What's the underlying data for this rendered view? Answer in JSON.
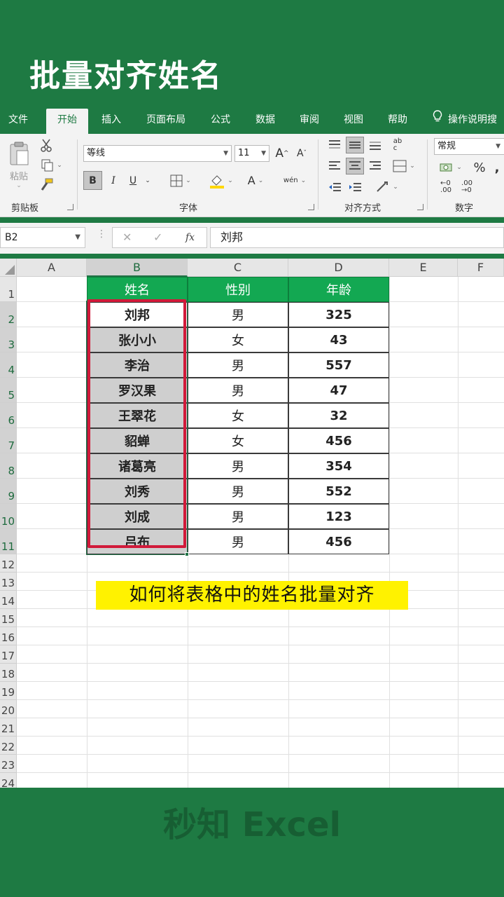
{
  "page_title": "批量对齐姓名",
  "ribbon": {
    "tabs": [
      "文件",
      "开始",
      "插入",
      "页面布局",
      "公式",
      "数据",
      "审阅",
      "视图",
      "帮助"
    ],
    "active_tab": "开始",
    "tell_me": "操作说明搜",
    "clipboard": {
      "paste": "粘贴",
      "label": "剪贴板"
    },
    "font": {
      "name": "等线",
      "size": "11",
      "bold": "B",
      "italic": "I",
      "underline": "U",
      "font_color_letter": "A",
      "phonetic": "wén",
      "label": "字体"
    },
    "alignment": {
      "label": "对齐方式"
    },
    "number": {
      "format": "常规",
      "percent": "%",
      "comma": ",",
      "label": "数字"
    }
  },
  "formula_bar": {
    "name_box": "B2",
    "cancel": "✕",
    "enter": "✓",
    "fx": "fx",
    "value": "刘邦"
  },
  "sheet": {
    "columns": [
      "A",
      "B",
      "C",
      "D",
      "E",
      "F"
    ],
    "rows": [
      "1",
      "2",
      "3",
      "4",
      "5",
      "6",
      "7",
      "8",
      "9",
      "10",
      "11",
      "12",
      "13",
      "14",
      "15",
      "16",
      "17",
      "18",
      "19",
      "20",
      "21",
      "22",
      "23",
      "24"
    ],
    "headers": [
      "姓名",
      "性别",
      "年龄"
    ],
    "data": [
      [
        "刘邦",
        "男",
        "325"
      ],
      [
        "张小小",
        "女",
        "43"
      ],
      [
        "李治",
        "男",
        "557"
      ],
      [
        "罗汉果",
        "男",
        "47"
      ],
      [
        "王翠花",
        "女",
        "32"
      ],
      [
        "貂蝉",
        "女",
        "456"
      ],
      [
        "诸葛亮",
        "男",
        "354"
      ],
      [
        "刘秀",
        "男",
        "552"
      ],
      [
        "刘成",
        "男",
        "123"
      ],
      [
        "吕布",
        "男",
        "456"
      ]
    ]
  },
  "caption": "如何将表格中的姓名批量对齐",
  "brand": "秒知 Excel",
  "colors": {
    "accent_green": "#1e7a43",
    "header_green": "#13a852",
    "highlight_red": "#d11a3a",
    "caption_yellow": "#fff200"
  }
}
